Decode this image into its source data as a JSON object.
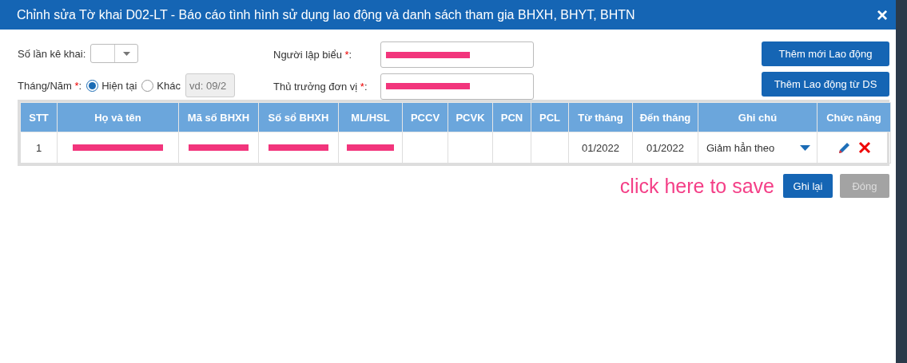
{
  "dialog": {
    "title": "Chỉnh sửa Tờ khai D02-LT - Báo cáo tình hình sử dụng lao động và danh sách tham gia BHXH, BHYT, BHTN",
    "close": "×"
  },
  "form": {
    "declaration_count": {
      "label": "Số lần kê khai:"
    },
    "period": {
      "label": "Tháng/Năm",
      "required": "*",
      "colon": ":",
      "options": [
        {
          "label": "Hiện tại",
          "selected": true
        },
        {
          "label": "Khác",
          "selected": false
        }
      ],
      "placeholder": "vd: 09/2",
      "disabled": true
    },
    "preparer": {
      "label": "Người lập biểu",
      "required": "*",
      "colon": ":",
      "redacted": true
    },
    "head": {
      "label": "Thủ trưởng đơn vị",
      "required": "*",
      "colon": ":",
      "redacted": true
    }
  },
  "side_buttons": [
    "Thêm mới Lao động",
    "Thêm Lao động từ DS"
  ],
  "table": {
    "columns": [
      "STT",
      "Họ và tên",
      "Mã số BHXH",
      "Số sổ BHXH",
      "ML/HSL",
      "PCCV",
      "PCVK",
      "PCN",
      "PCL",
      "Từ tháng",
      "Đến tháng",
      "Ghi chú",
      "Chức năng"
    ],
    "rows": [
      {
        "cells": [
          {
            "text": "1"
          },
          {
            "redacted": true
          },
          {
            "redacted": true
          },
          {
            "redacted": true
          },
          {
            "redacted": true
          },
          {
            "text": ""
          },
          {
            "text": ""
          },
          {
            "text": ""
          },
          {
            "text": ""
          },
          {
            "text": "01/2022"
          },
          {
            "text": "01/2022"
          },
          {
            "kind": "select",
            "text": "Giảm hẳn theo"
          },
          {
            "kind": "actions"
          }
        ]
      }
    ]
  },
  "annotation": "click here to save",
  "footer_buttons": [
    {
      "label": "Ghi lại",
      "disabled": false
    },
    {
      "label": "Đóng",
      "disabled": true
    }
  ]
}
